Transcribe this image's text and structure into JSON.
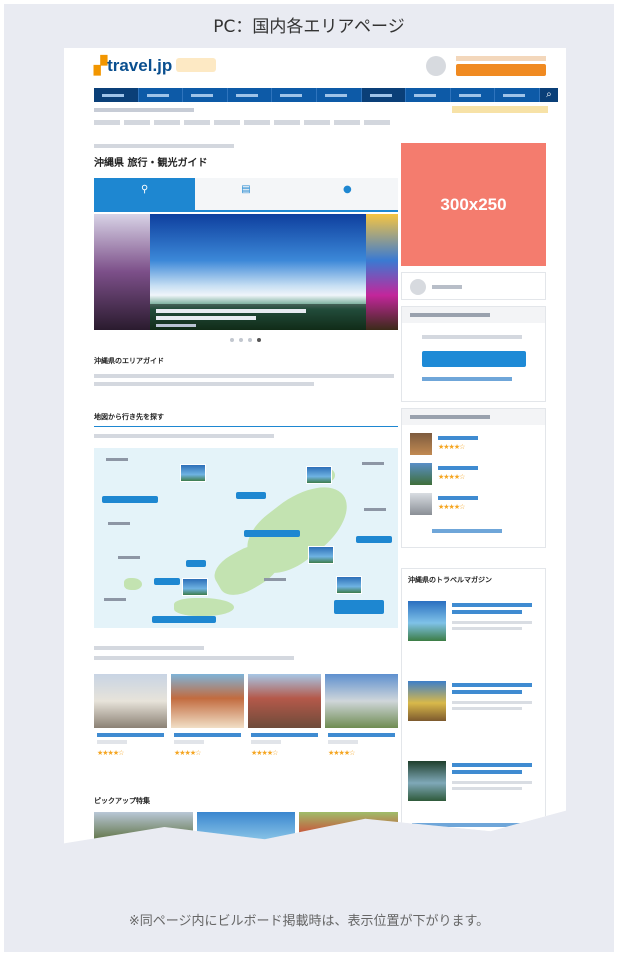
{
  "caption_top": "PC：国内各エリアページ",
  "caption_bottom": "※同ページ内にビルボード掲載時は、表示位置が下がります。",
  "ad_slot": {
    "label": "300x250",
    "color": "#f47c6e"
  },
  "site": {
    "logo_text": "travel.jp",
    "page_title": "沖縄県 旅行・観光ガイド",
    "tabs": [
      {
        "icon": "map-pin-icon"
      },
      {
        "icon": "book-icon"
      },
      {
        "icon": "question-icon"
      }
    ],
    "section_titles": {
      "area_guide": "沖縄県のエリアガイド",
      "map_search": "地図から行き先を探す",
      "pickup": "ピックアップ特集",
      "magazine": "沖縄県のトラベルマガジン"
    }
  },
  "colors": {
    "brand_blue": "#0d5aa7",
    "accent_orange": "#f08a21",
    "link_blue": "#1e87d1"
  }
}
